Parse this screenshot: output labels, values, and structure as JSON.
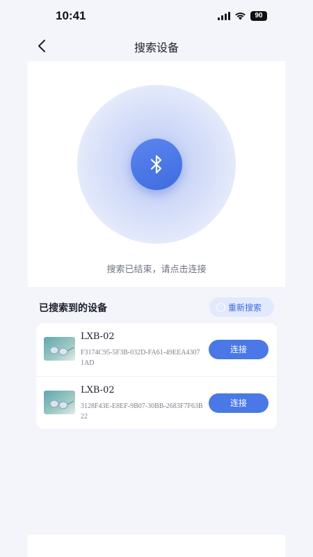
{
  "status_bar": {
    "time": "10:41",
    "battery": "90",
    "icons": [
      "cellular-signal-icon",
      "wifi-icon",
      "battery-icon"
    ]
  },
  "header": {
    "title": "搜索设备",
    "back_icon": "chevron-left-icon"
  },
  "scan": {
    "icon": "bluetooth-icon",
    "status_text": "搜索已结束，请点击连接",
    "accent_color": "#3f6be0"
  },
  "devices_section": {
    "title": "已搜索到的设备",
    "rescan_label": "重新搜索",
    "connect_label": "连接",
    "items": [
      {
        "name": "LXB-02",
        "id": "F3174C95-5F3B-032D-FA61-49EEA43071AD",
        "thumbnail": "glasses-product-image"
      },
      {
        "name": "LXB-02",
        "id": "3128F43E-E8EF-9B07-30BB-2683F7F63B22",
        "thumbnail": "glasses-product-image"
      }
    ]
  },
  "colors": {
    "page_background": "#f3f5fb",
    "primary_button": "#4a78e6",
    "rescan_button_bg": "#e1e9fd"
  }
}
